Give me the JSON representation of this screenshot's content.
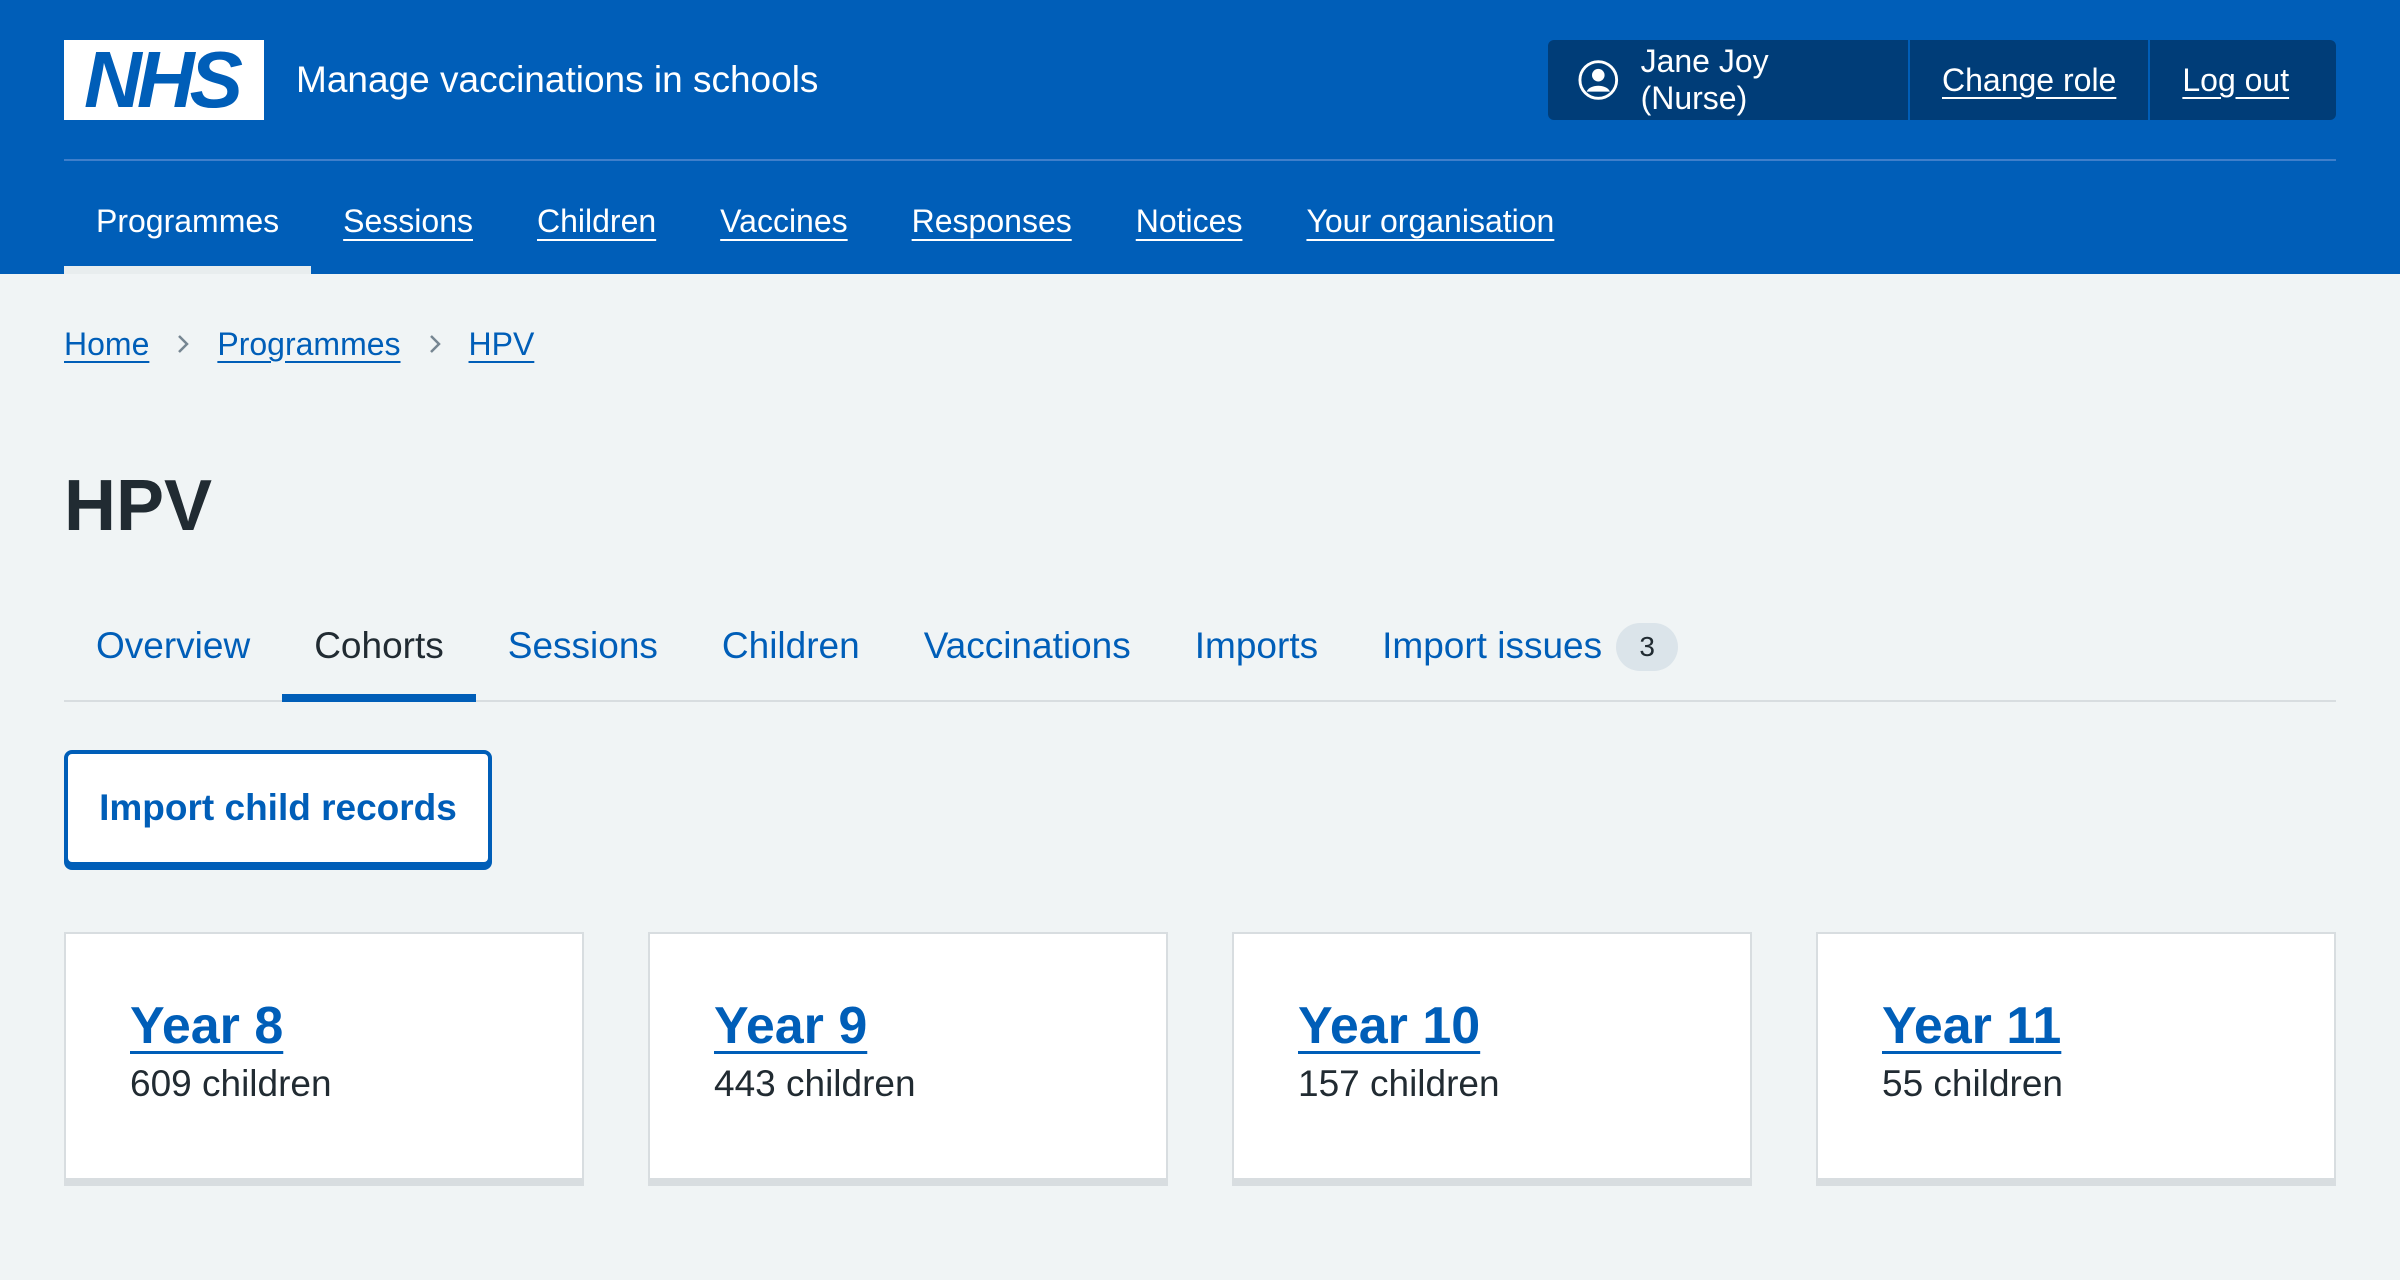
{
  "header": {
    "logo_text": "NHS",
    "service_name": "Manage vaccinations in schools",
    "account": {
      "user": "Jane Joy (Nurse)",
      "user_icon": "user-circle-icon",
      "change_role": "Change role",
      "log_out": "Log out"
    },
    "nav": [
      {
        "label": "Programmes",
        "current": true
      },
      {
        "label": "Sessions"
      },
      {
        "label": "Children"
      },
      {
        "label": "Vaccines"
      },
      {
        "label": "Responses"
      },
      {
        "label": "Notices"
      },
      {
        "label": "Your organisation"
      }
    ]
  },
  "breadcrumb": [
    "Home",
    "Programmes",
    "HPV"
  ],
  "page": {
    "title": "HPV",
    "tabs": [
      {
        "label": "Overview"
      },
      {
        "label": "Cohorts",
        "active": true
      },
      {
        "label": "Sessions"
      },
      {
        "label": "Children"
      },
      {
        "label": "Vaccinations"
      },
      {
        "label": "Imports"
      },
      {
        "label": "Import issues",
        "count": "3"
      }
    ],
    "import_button": "Import child records",
    "cohorts": [
      {
        "title": "Year 8",
        "count": "609 children"
      },
      {
        "title": "Year 9",
        "count": "443 children"
      },
      {
        "title": "Year 10",
        "count": "157 children"
      },
      {
        "title": "Year 11",
        "count": "55 children"
      }
    ]
  },
  "colors": {
    "brand_blue": "#005eb8",
    "account_bg": "#003d78",
    "page_bg": "#f0f4f5",
    "text": "#212b32"
  }
}
